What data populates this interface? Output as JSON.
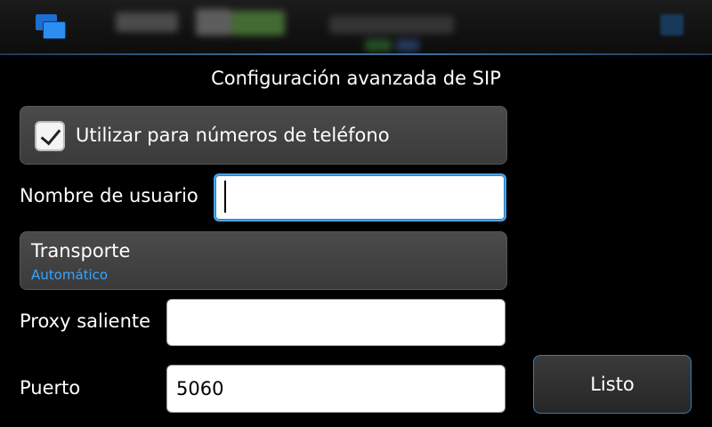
{
  "statusbar": {
    "app_title": "Configuraciones",
    "time": "13:11"
  },
  "page": {
    "title": "Configuración avanzada de SIP"
  },
  "phone_numbers": {
    "label": "Utilizar para números de teléfono",
    "checked": true
  },
  "username": {
    "label": "Nombre de usuario",
    "value": ""
  },
  "transport": {
    "label": "Transporte",
    "value": "Automático"
  },
  "outbound_proxy": {
    "label": "Proxy saliente",
    "value": ""
  },
  "port": {
    "label": "Puerto",
    "value": "5060"
  },
  "done_button": {
    "label": "Listo"
  },
  "colors": {
    "accent": "#3aa3ff",
    "focus_border": "#4aa6e8",
    "background": "#000000"
  },
  "icons": {
    "switcher": "task-switcher-icon",
    "close": "close-icon"
  }
}
